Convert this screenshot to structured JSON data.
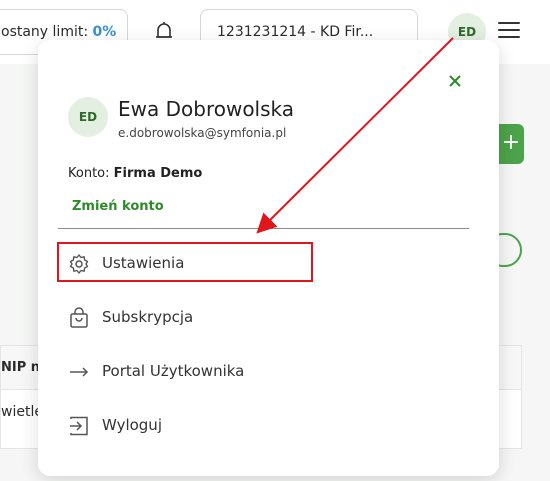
{
  "topbar": {
    "limit_label": "ostany limit:",
    "limit_value": "0%",
    "company": "1231231214 - KD  Fir...",
    "avatar_initials": "ED",
    "icons": [
      "bell-icon",
      "chevron-down-icon",
      "menu-icon"
    ]
  },
  "background": {
    "add_button": "+",
    "table_header": "NIP na",
    "table_row": "wietle"
  },
  "panel": {
    "avatar_initials": "ED",
    "user_name": "Ewa Dobrowolska",
    "user_email": "e.dobrowolska@symfonia.pl",
    "konto_label": "Konto:",
    "konto_value": "Firma Demo",
    "change_account": "Zmień konto",
    "menu": [
      {
        "label": "Ustawienia",
        "icon": "gear-icon"
      },
      {
        "label": "Subskrypcja",
        "icon": "shopping-bag-icon"
      },
      {
        "label": "Portal Użytkownika",
        "icon": "arrow-right-icon"
      },
      {
        "label": "Wyloguj",
        "icon": "logout-icon"
      }
    ]
  },
  "annotation": {
    "highlight_color": "#e0161c",
    "arrow_color": "#e0161c"
  },
  "colors": {
    "accent_green": "#2f8a2b",
    "avatar_bg": "#e3efe0",
    "limit_blue": "#3d8fd1"
  }
}
